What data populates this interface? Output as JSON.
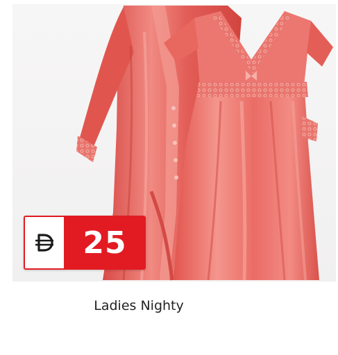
{
  "product": {
    "name": "Ladies Nighty",
    "price": {
      "currency_icon": "dirham-currency-icon",
      "amount": "25"
    },
    "image_icon": "nightwear-set-photo"
  },
  "colors": {
    "badge_red": "#e21b23",
    "garment_coral": "#e9635c"
  }
}
